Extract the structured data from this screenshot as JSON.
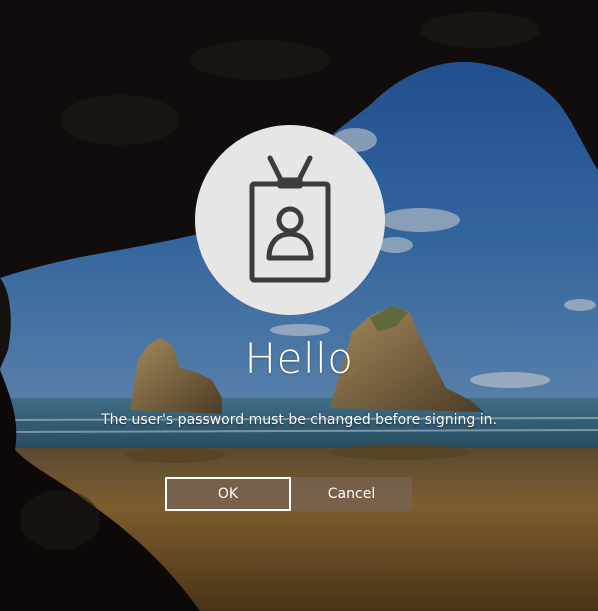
{
  "scene": {
    "colors": {
      "sky_top": "#2c6ab8",
      "sky_bottom": "#5b90c9",
      "sea": "#3d6f8e",
      "sand": "#8a6634",
      "cave_rock": "#141210",
      "avatar_circle": "#e6e6e6",
      "icon_stroke": "#3c3c3c",
      "button_fill": "#7a6555"
    }
  },
  "avatar": {
    "icon": "badge-user-icon"
  },
  "greeting": "Hello",
  "message": "The user's password must be changed before signing in.",
  "buttons": {
    "ok_label": "OK",
    "cancel_label": "Cancel"
  }
}
